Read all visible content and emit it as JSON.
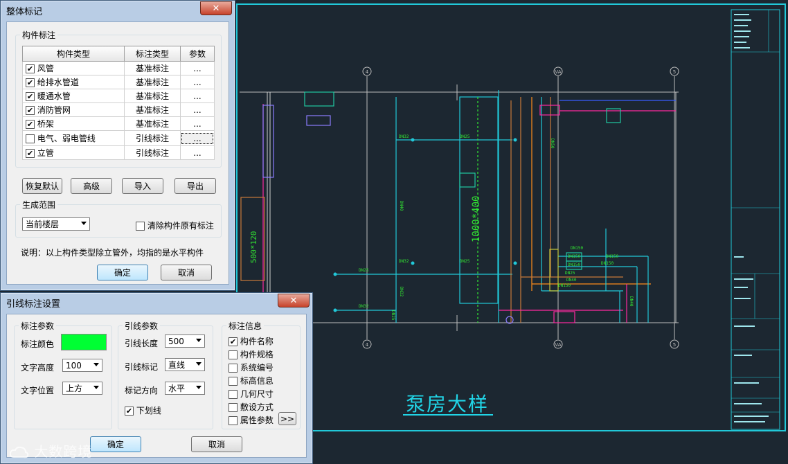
{
  "drawing": {
    "title": "泵房大样",
    "grid_labels": [
      "4",
      "VA",
      "5"
    ],
    "pipe_labels": [
      "DN32",
      "DN25",
      "DN40",
      "DN32",
      "DN25",
      "DN25",
      "DN32",
      "DN32",
      "DN25",
      "DN150",
      "DN150",
      "DN150",
      "DN150",
      "DN150",
      "DN40",
      "DN25",
      "DN150",
      "DN50",
      "DN40"
    ],
    "dim_labels": [
      "1000*400",
      "500*120"
    ]
  },
  "dialog1": {
    "title": "整体标记",
    "close": "✕",
    "group_title": "构件标注",
    "columns": [
      "构件类型",
      "标注类型",
      "参数"
    ],
    "rows": [
      {
        "checked": true,
        "type": "风管",
        "mark": "基准标注",
        "param": "..."
      },
      {
        "checked": true,
        "type": "给排水管道",
        "mark": "基准标注",
        "param": "..."
      },
      {
        "checked": true,
        "type": "暖通水管",
        "mark": "基准标注",
        "param": "..."
      },
      {
        "checked": true,
        "type": "消防管网",
        "mark": "基准标注",
        "param": "..."
      },
      {
        "checked": true,
        "type": "桥架",
        "mark": "基准标注",
        "param": "..."
      },
      {
        "checked": false,
        "type": "电气、弱电管线",
        "mark": "引线标注",
        "param": "..."
      },
      {
        "checked": true,
        "type": "立管",
        "mark": "引线标注",
        "param": "..."
      }
    ],
    "buttons": {
      "restore": "恢复默认",
      "advanced": "高级",
      "import": "导入",
      "export": "导出"
    },
    "scope_title": "生成范围",
    "scope_value": "当前楼层",
    "clear_label": "清除构件原有标注",
    "note": "说明：以上构件类型除立管外，均指的是水平构件",
    "ok": "确定",
    "cancel": "取消"
  },
  "dialog2": {
    "title": "引线标注设置",
    "close": "✕",
    "mark_params_title": "标注参数",
    "color_label": "标注颜色",
    "color_value": "#00ff33",
    "text_height_label": "文字高度",
    "text_height_value": "100",
    "text_pos_label": "文字位置",
    "text_pos_value": "上方",
    "lead_params_title": "引线参数",
    "lead_len_label": "引线长度",
    "lead_len_value": "500",
    "lead_mark_label": "引线标记",
    "lead_mark_value": "直线",
    "mark_dir_label": "标记方向",
    "mark_dir_value": "水平",
    "underline_label": "下划线",
    "info_title": "标注信息",
    "info_items": [
      {
        "label": "构件名称",
        "checked": true
      },
      {
        "label": "构件规格",
        "checked": false
      },
      {
        "label": "系统编号",
        "checked": false
      },
      {
        "label": "标高信息",
        "checked": false
      },
      {
        "label": "几何尺寸",
        "checked": false
      },
      {
        "label": "敷设方式",
        "checked": false
      },
      {
        "label": "属性参数",
        "checked": false
      }
    ],
    "more": ">>",
    "ok": "确定",
    "cancel": "取消"
  },
  "watermark": "大数跨境"
}
